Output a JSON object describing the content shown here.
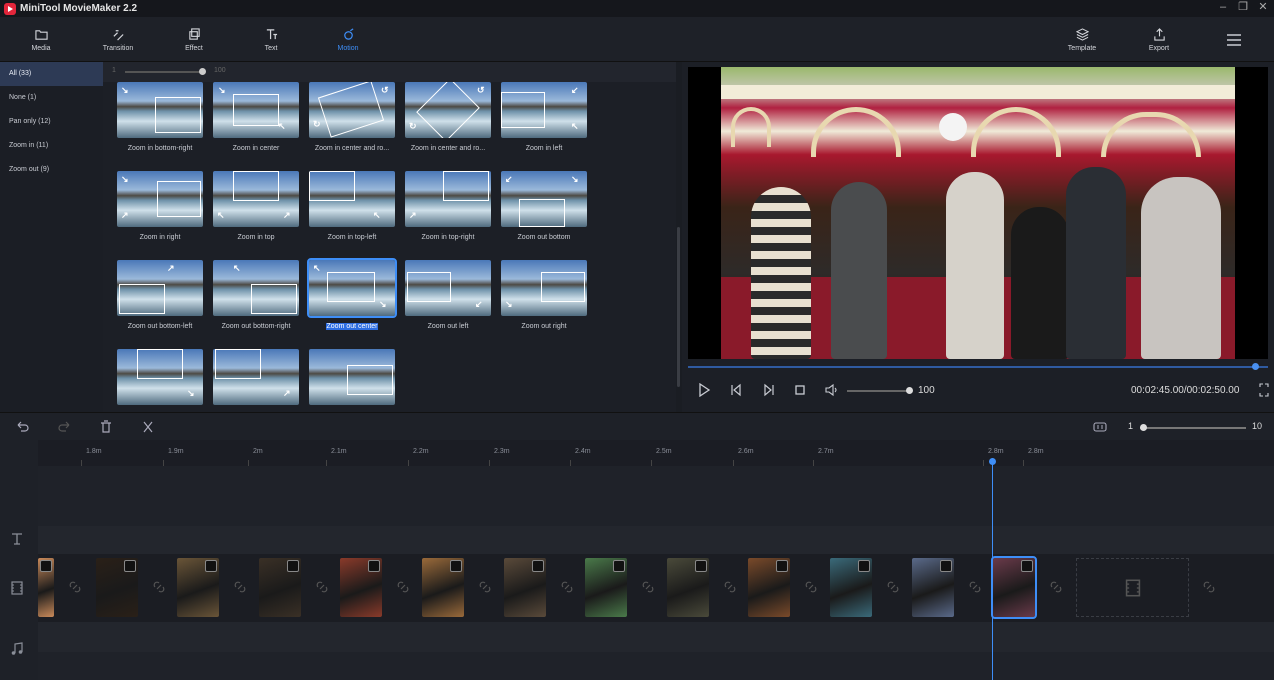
{
  "app": {
    "title": "MiniTool MovieMaker 2.2"
  },
  "toolbar": {
    "items": [
      {
        "label": "Media",
        "icon": "folder-icon"
      },
      {
        "label": "Transition",
        "icon": "transition-icon"
      },
      {
        "label": "Effect",
        "icon": "effect-icon"
      },
      {
        "label": "Text",
        "icon": "text-icon"
      },
      {
        "label": "Motion",
        "icon": "motion-icon",
        "active": true
      }
    ],
    "template_label": "Template",
    "export_label": "Export"
  },
  "categories": [
    {
      "label": "All (33)",
      "selected": true
    },
    {
      "label": "None (1)"
    },
    {
      "label": "Pan only (12)"
    },
    {
      "label": "Zoom in (11)"
    },
    {
      "label": "Zoom out (9)"
    }
  ],
  "size_slider": {
    "min": "1",
    "max": "100",
    "value": 100
  },
  "motions": [
    {
      "label": "Zoom in bottom-right"
    },
    {
      "label": "Zoom in center"
    },
    {
      "label": "Zoom in center and ro..."
    },
    {
      "label": "Zoom in center and ro..."
    },
    {
      "label": "Zoom in left"
    },
    {
      "label": "Zoom in right"
    },
    {
      "label": "Zoom in top"
    },
    {
      "label": "Zoom in top-left"
    },
    {
      "label": "Zoom in top-right"
    },
    {
      "label": "Zoom out bottom"
    },
    {
      "label": "Zoom out bottom-left"
    },
    {
      "label": "Zoom out bottom-right"
    },
    {
      "label": "Zoom out center",
      "selected": true
    },
    {
      "label": "Zoom out left"
    },
    {
      "label": "Zoom out right"
    },
    {
      "label": ""
    },
    {
      "label": ""
    },
    {
      "label": ""
    }
  ],
  "player": {
    "progress": 0.98,
    "volume": "100",
    "time": "00:02:45.00/00:02:50.00"
  },
  "timeline": {
    "zoom": {
      "min": "1",
      "max": "10",
      "value": 1
    },
    "ruler": [
      "1.8m",
      "1.9m",
      "2m",
      "2.1m",
      "2.2m",
      "2.3m",
      "2.4m",
      "2.5m",
      "2.6m",
      "2.7m",
      "2.8m",
      "2.8m"
    ],
    "clip_colors": [
      "#c98a5a",
      "#2a2018",
      "#6a5538",
      "#3a3026",
      "#8a3a2a",
      "#9a6a3a",
      "#5a4a3a",
      "#4a7a4a",
      "#4a4a3a",
      "#7a4a2a",
      "#3a6a7a",
      "#5a6a8a",
      "#6a3a4a"
    ]
  },
  "colors": {
    "accent": "#3e8ef7",
    "brand": "#e3263b"
  }
}
